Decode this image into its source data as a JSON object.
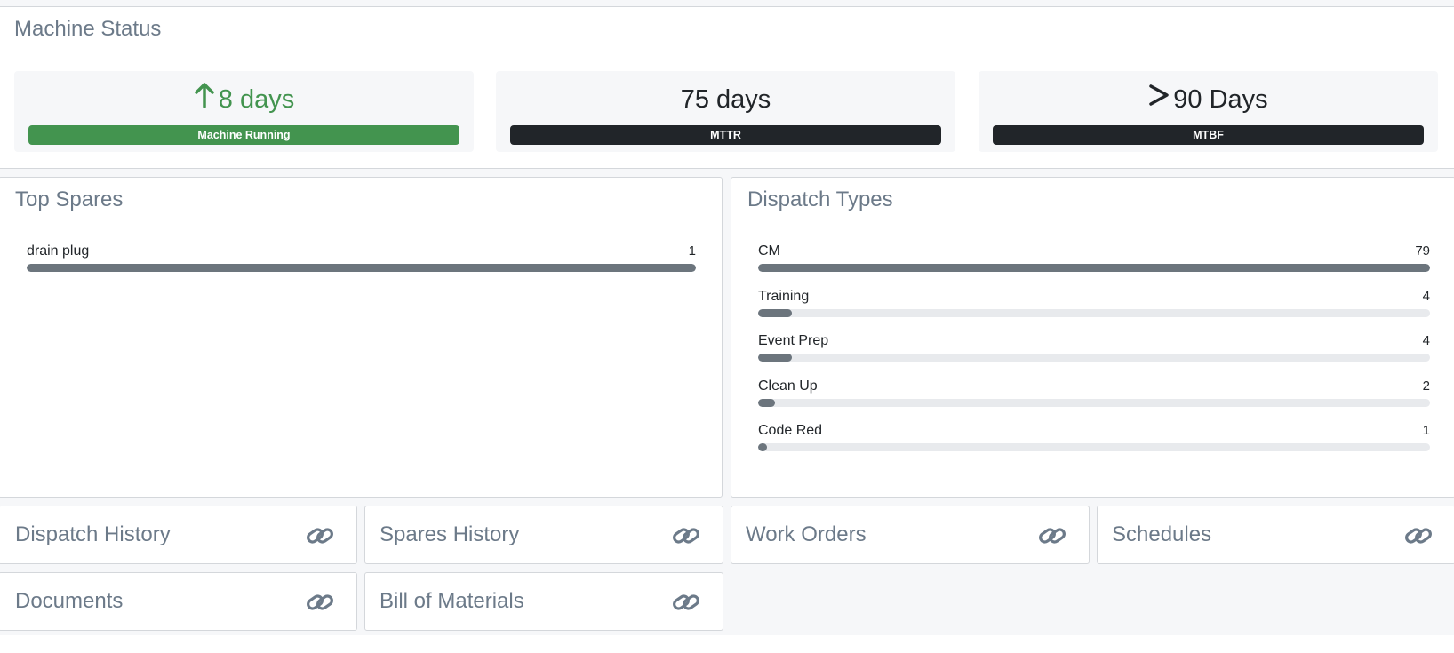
{
  "machine_status": {
    "title": "Machine Status",
    "stats": [
      {
        "value": "8 days",
        "label": "Machine Running",
        "icon": "arrow-up-icon",
        "color": "#43944f"
      },
      {
        "value": "75 days",
        "label": "MTTR",
        "color": "#212529"
      },
      {
        "value": "90 Days",
        "label": "MTBF",
        "icon": "greater-than-icon",
        "color": "#212529"
      }
    ]
  },
  "top_spares": {
    "title": "Top Spares",
    "items": [
      {
        "label": "drain plug",
        "count": "1",
        "fraction": 1.0
      }
    ]
  },
  "dispatch_types": {
    "title": "Dispatch Types",
    "items": [
      {
        "label": "CM",
        "count": "79",
        "fraction": 1.0
      },
      {
        "label": "Training",
        "count": "4",
        "fraction": 0.05
      },
      {
        "label": "Event Prep",
        "count": "4",
        "fraction": 0.05
      },
      {
        "label": "Clean Up",
        "count": "2",
        "fraction": 0.025
      },
      {
        "label": "Code Red",
        "count": "1",
        "fraction": 0.013
      }
    ]
  },
  "links": [
    {
      "label": "Dispatch History",
      "icon": "link-icon"
    },
    {
      "label": "Spares History",
      "icon": "link-icon"
    },
    {
      "label": "Work Orders",
      "icon": "link-icon"
    },
    {
      "label": "Schedules",
      "icon": "link-icon"
    },
    {
      "label": "Documents",
      "icon": "link-icon"
    },
    {
      "label": "Bill of Materials",
      "icon": "link-icon"
    }
  ],
  "colors": {
    "running": "#43944f",
    "dark": "#212529",
    "bar_fill": "#6c757d",
    "bar_track": "#e8eaed",
    "title": "#6c7a89"
  }
}
